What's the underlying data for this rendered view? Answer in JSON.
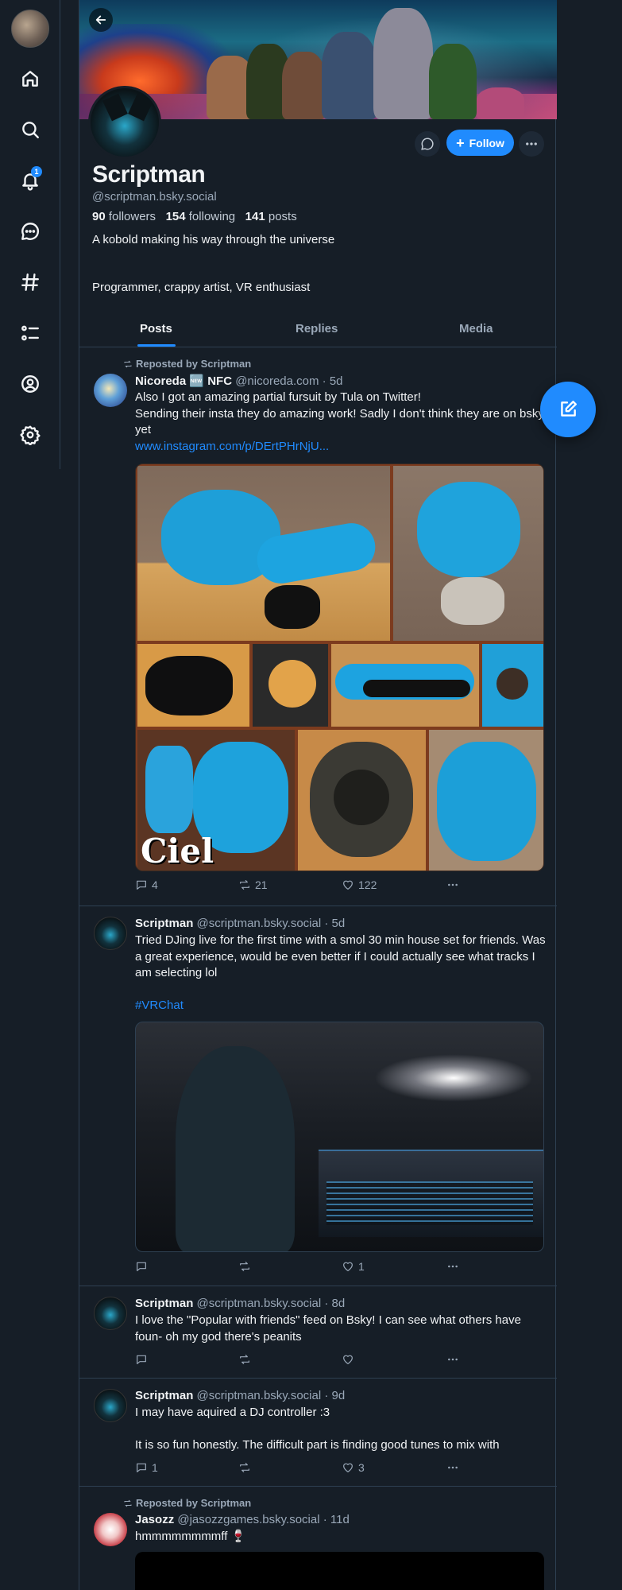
{
  "nav": {
    "items": [
      "home",
      "search",
      "notifications",
      "chat",
      "feeds",
      "lists",
      "profile",
      "settings"
    ],
    "notification_count": "1"
  },
  "profile": {
    "display_name": "Scriptman",
    "handle": "@scriptman.bsky.social",
    "followers_count": "90",
    "followers_label": "followers",
    "following_count": "154",
    "following_label": "following",
    "posts_count": "141",
    "posts_label": "posts",
    "bio_line1": "A kobold making his way through the universe",
    "bio_line2": "Programmer, crappy artist, VR enthusiast",
    "follow_label": "Follow"
  },
  "tabs": [
    "Posts",
    "Replies",
    "Media"
  ],
  "posts": [
    {
      "repost_label": "Reposted by Scriptman",
      "name": "Nicoreda 🆕 NFC",
      "handle": "@nicoreda.com",
      "time": "· 5d",
      "text": "Also I got an amazing partial fursuit by Tula on Twitter!\nSending their insta they do amazing work! Sadly I don't think they are on bsky yet",
      "link": "www.instagram.com/p/DErtPHrNjU...",
      "replies": "4",
      "reposts": "21",
      "likes": "122",
      "collage_label": "Ciel"
    },
    {
      "name": "Scriptman",
      "handle": "@scriptman.bsky.social",
      "time": "· 5d",
      "text": "Tried DJing live for the first time with a smol 30 min house set for friends. Was a great experience, would be even better if I could actually see what tracks I am selecting lol",
      "tag": "#VRChat",
      "replies": "",
      "reposts": "",
      "likes": "1"
    },
    {
      "name": "Scriptman",
      "handle": "@scriptman.bsky.social",
      "time": "· 8d",
      "text": "I love the \"Popular with friends\" feed on Bsky! I can see what others have foun- oh my god there's peanits",
      "replies": "",
      "reposts": "",
      "likes": ""
    },
    {
      "name": "Scriptman",
      "handle": "@scriptman.bsky.social",
      "time": "· 9d",
      "text": "I may have aquired a DJ controller :3",
      "text2": "It is so fun honestly. The difficult part is finding good tunes to mix with",
      "replies": "1",
      "reposts": "",
      "likes": "3"
    },
    {
      "repost_label": "Reposted by Scriptman",
      "name": "Jasozz",
      "handle": "@jasozzgames.bsky.social",
      "time": "· 11d",
      "text": "hmmmmmmmmff 🍷"
    }
  ],
  "colors": {
    "background": "#161e27",
    "accent": "#208bfe",
    "muted_text": "#9aa8b8",
    "border": "#2e4052"
  }
}
